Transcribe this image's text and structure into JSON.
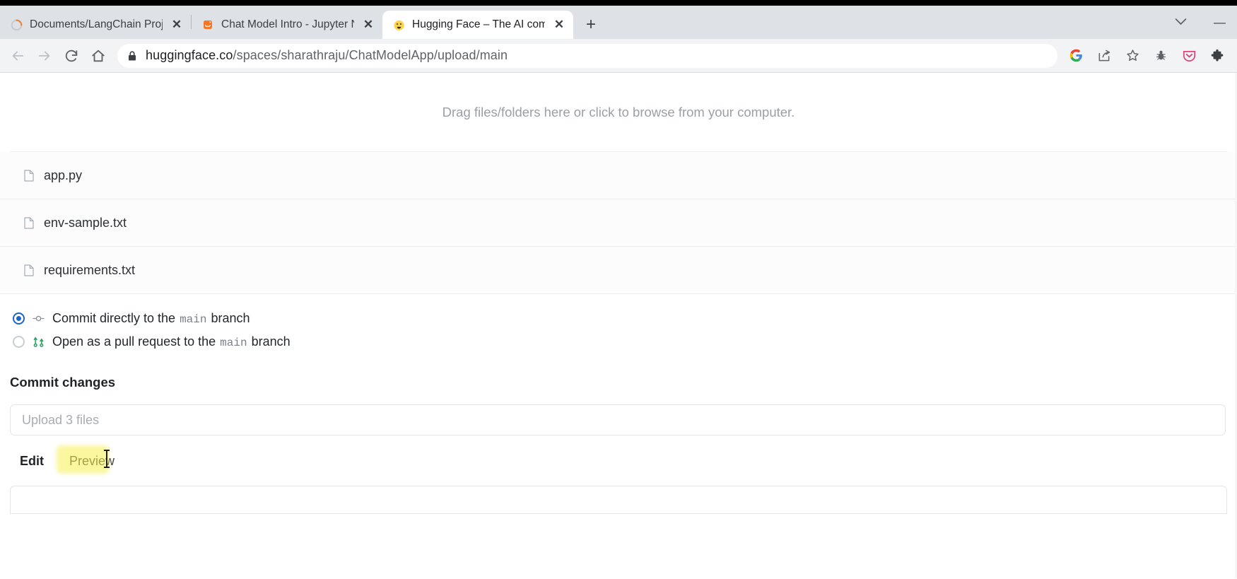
{
  "browser": {
    "tabs": [
      {
        "title": "Documents/LangChain Projects/",
        "favicon": "spinner-icon",
        "active": false,
        "close_label": "✕"
      },
      {
        "title": "Chat Model Intro - Jupyter Notes",
        "favicon": "jupyter-icon",
        "active": false,
        "close_label": "✕"
      },
      {
        "title": "Hugging Face – The AI communi",
        "favicon": "huggingface-icon",
        "active": true,
        "close_label": "✕"
      }
    ],
    "new_tab_label": "+",
    "tab_list_chevron": "⌄",
    "window_minimize": "—",
    "nav": {
      "back": "←",
      "forward": "→",
      "reload": "⟳",
      "home": "⌂"
    },
    "url": {
      "host": "huggingface.co",
      "path": "/spaces/sharathraju/ChatModelApp/upload/main",
      "full": "huggingface.co/spaces/sharathraju/ChatModelApp/upload/main",
      "lock": "lock-icon"
    },
    "toolbar_icons": [
      {
        "name": "google-icon",
        "label": "G"
      },
      {
        "name": "share-icon",
        "label": ""
      },
      {
        "name": "bookmark-star-icon",
        "label": ""
      },
      {
        "name": "bug-icon",
        "label": ""
      },
      {
        "name": "pocket-icon",
        "label": ""
      },
      {
        "name": "extensions-puzzle-icon",
        "label": ""
      }
    ]
  },
  "page": {
    "dropzone": {
      "text": "Drag files/folders here or click to browse from your computer."
    },
    "files": [
      {
        "name": "app.py",
        "icon": "file-icon"
      },
      {
        "name": "env-sample.txt",
        "icon": "file-icon"
      },
      {
        "name": "requirements.txt",
        "icon": "file-icon"
      }
    ],
    "branch_options": [
      {
        "prefix": "Commit directly to the",
        "branch": "main",
        "suffix": "branch",
        "selected": true,
        "icon": "commit-node-icon"
      },
      {
        "prefix": "Open as a pull request to the",
        "branch": "main",
        "suffix": "branch",
        "selected": false,
        "icon": "pull-request-icon"
      }
    ],
    "commit": {
      "heading": "Commit changes",
      "summary_placeholder": "Upload 3 files",
      "summary_value": ""
    },
    "editor_tabs": [
      {
        "label": "Edit",
        "active": true
      },
      {
        "label": "Preview",
        "active": false
      }
    ]
  },
  "colors": {
    "accent_blue": "#1b66c9",
    "pr_green": "#2f9e63",
    "tab_strip": "#dee1e6",
    "toolbar": "#f1f3f4",
    "cursor_highlight": "#f5f050"
  }
}
